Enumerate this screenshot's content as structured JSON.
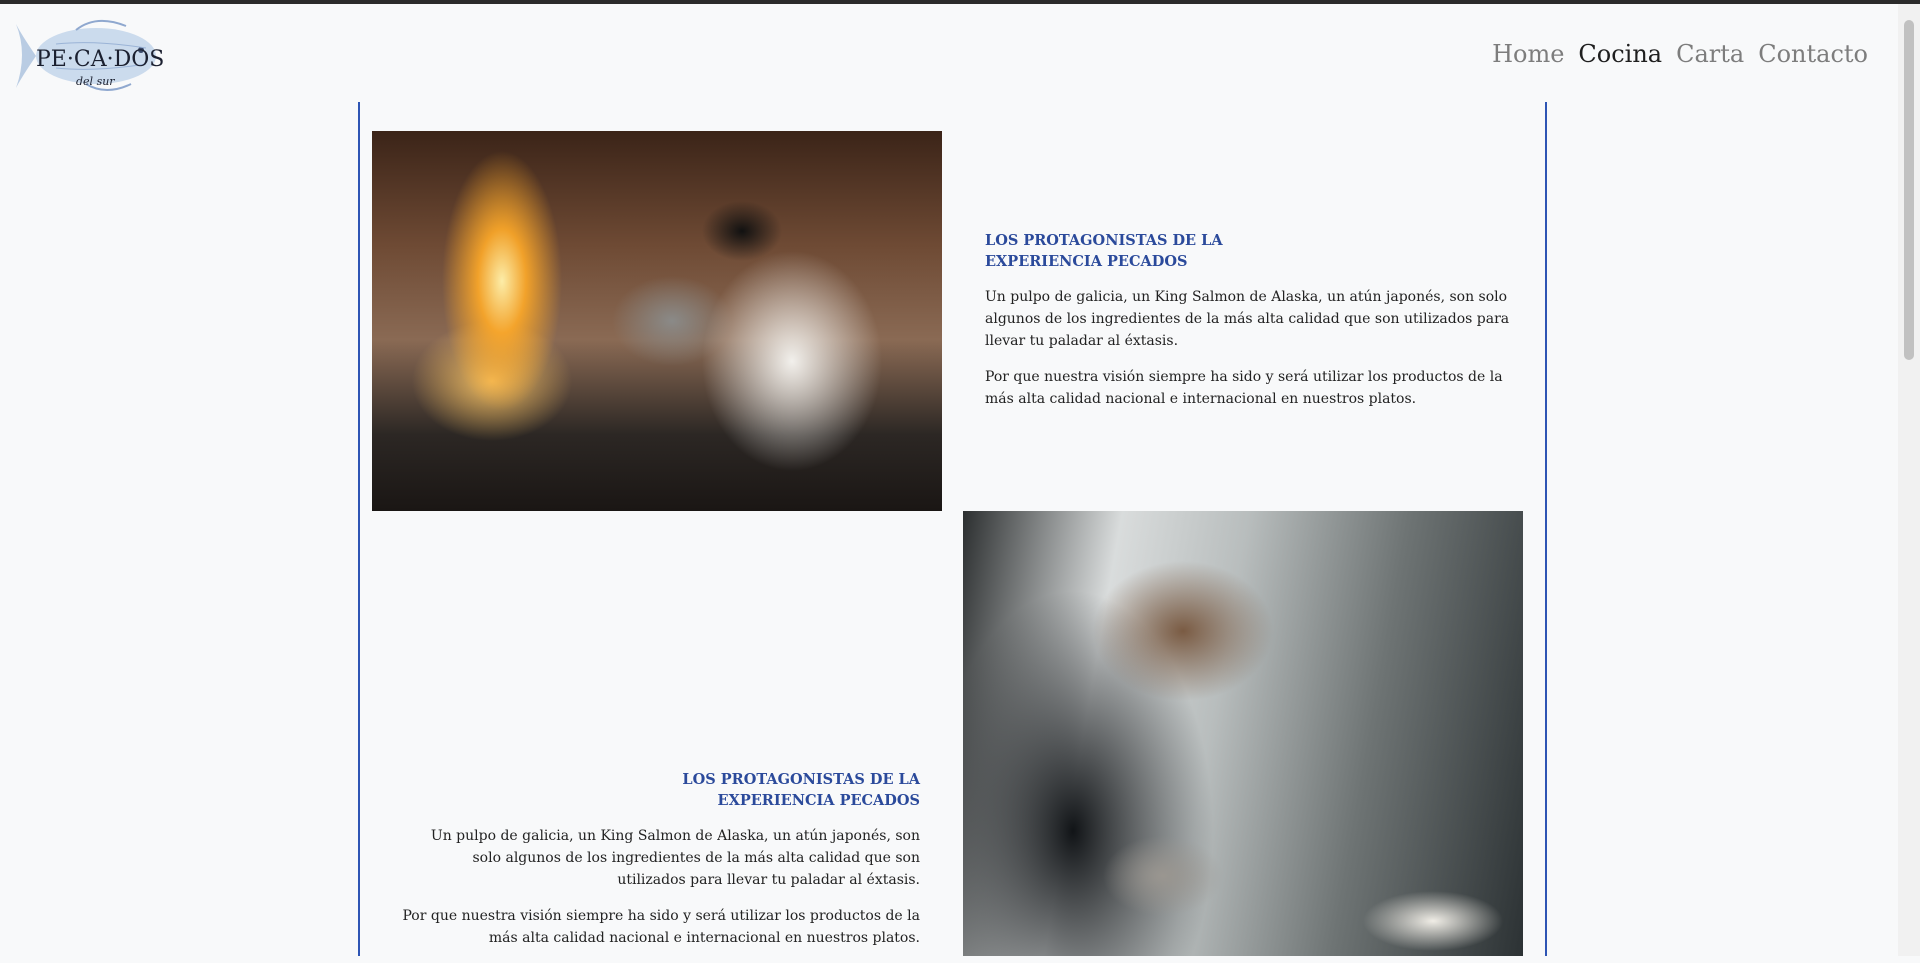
{
  "logo": {
    "wordmark": "PE·CA·DOS",
    "subtitle": "del sur"
  },
  "nav": {
    "items": [
      {
        "label": "Home",
        "active": false
      },
      {
        "label": "Cocina",
        "active": true
      },
      {
        "label": "Carta",
        "active": false
      },
      {
        "label": "Contacto",
        "active": false
      }
    ]
  },
  "sections": [
    {
      "heading": "LOS PROTAGONISTAS DE LA EXPERIENCIA PECADOS",
      "paragraph1": "Un pulpo de galicia, un King Salmon de Alaska, un atún japonés, son solo algunos de los ingredientes de la más alta calidad que son utilizados para llevar tu paladar al éxtasis.",
      "paragraph2": "Por que nuestra visión siempre ha sido y será utilizar los productos de la más alta calidad nacional e internacional en nuestros platos."
    },
    {
      "heading": "LOS PROTAGONISTAS DE LA EXPERIENCIA PECADOS",
      "paragraph1": "Un pulpo de galicia, un King Salmon de Alaska, un atún japonés, son solo algunos de los ingredientes de la más alta calidad que son utilizados para llevar tu paladar al éxtasis.",
      "paragraph2": "Por que nuestra visión siempre ha sido y será utilizar los productos de la más alta calidad nacional e internacional en nuestros platos."
    }
  ],
  "colors": {
    "accent": "#2b4a9b",
    "border": "#2e55b4",
    "nav_inactive": "#7d7d7d",
    "nav_active": "#1f1f1f"
  }
}
